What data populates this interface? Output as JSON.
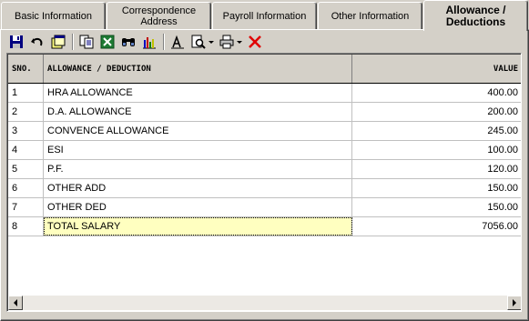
{
  "tabs": [
    {
      "label": "Basic Information"
    },
    {
      "label": "Correspondence Address"
    },
    {
      "label": "Payroll Information"
    },
    {
      "label": "Other Information"
    },
    {
      "label": "Allowance / Deductions",
      "active": true
    }
  ],
  "toolbar": {
    "icons": [
      "save-icon",
      "undo-icon",
      "note-icon",
      "copy-icon",
      "excel-icon",
      "find-icon",
      "chart-icon",
      "font-icon",
      "print-preview-icon",
      "print-icon",
      "delete-icon"
    ]
  },
  "grid": {
    "columns": {
      "sno": "SNO.",
      "name": "ALLOWANCE / DEDUCTION",
      "value": "VALUE"
    },
    "rows": [
      {
        "sno": "1",
        "name": "HRA ALLOWANCE",
        "value": "400.00"
      },
      {
        "sno": "2",
        "name": "D.A. ALLOWANCE",
        "value": "200.00"
      },
      {
        "sno": "3",
        "name": "CONVENCE ALLOWANCE",
        "value": "245.00"
      },
      {
        "sno": "4",
        "name": "ESI",
        "value": "100.00"
      },
      {
        "sno": "5",
        "name": "P.F.",
        "value": "120.00"
      },
      {
        "sno": "6",
        "name": "OTHER ADD",
        "value": "150.00"
      },
      {
        "sno": "7",
        "name": "OTHER DED",
        "value": "150.00"
      },
      {
        "sno": "8",
        "name": "TOTAL SALARY",
        "value": "7056.00"
      }
    ]
  },
  "colors": {
    "selected_cell": "#ffffc0",
    "delete": "#e00000"
  }
}
